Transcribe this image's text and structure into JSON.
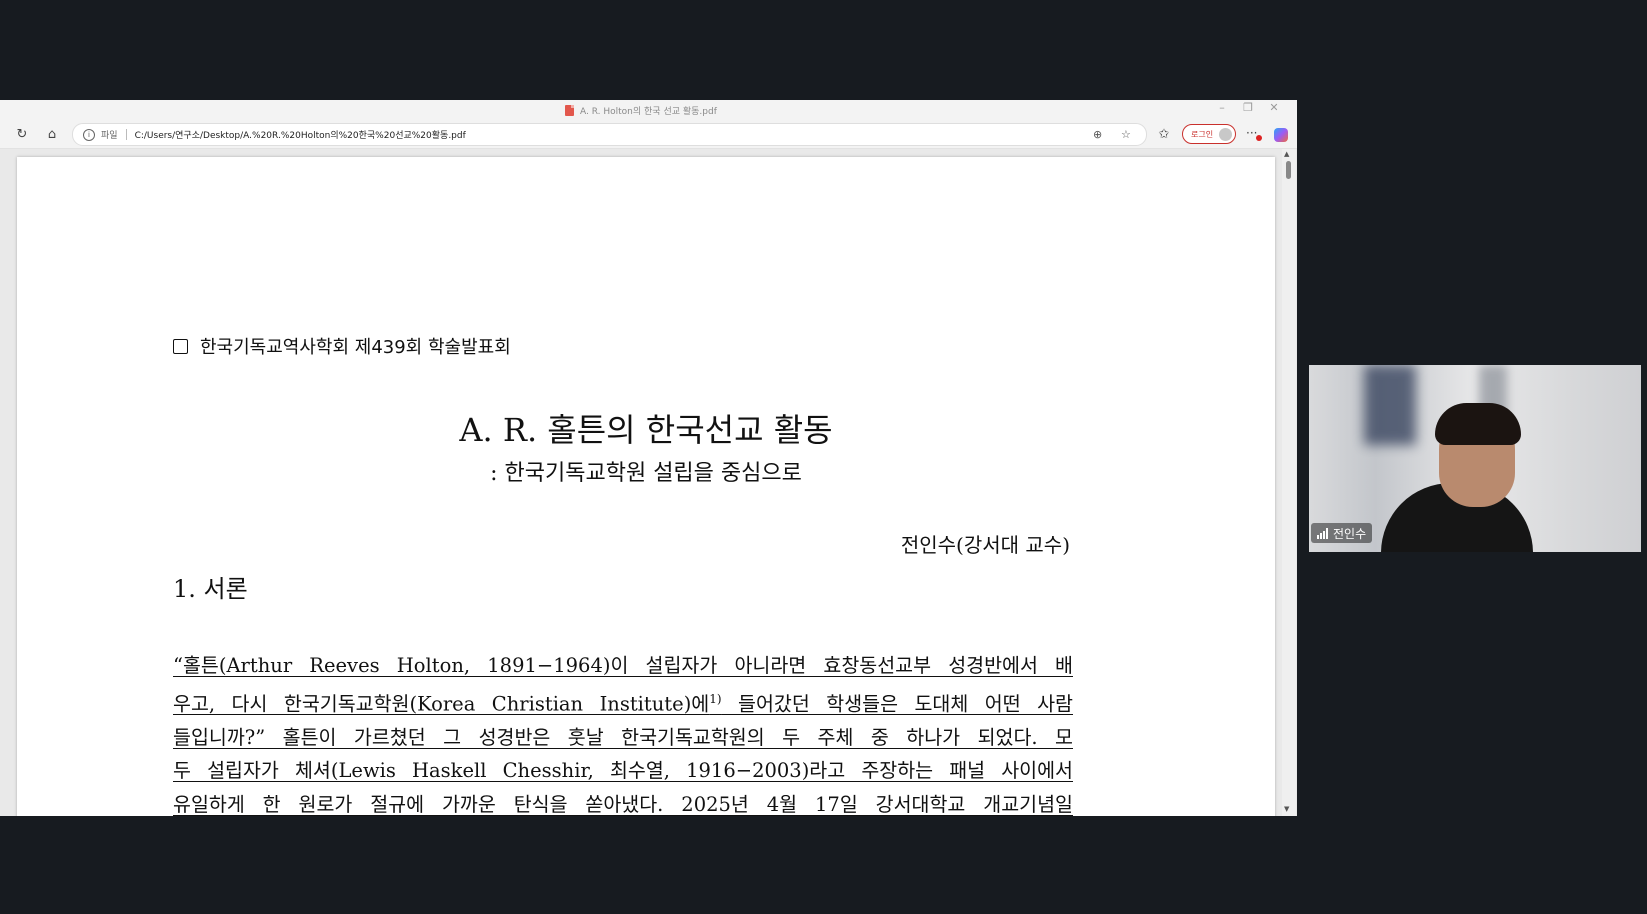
{
  "browser": {
    "window_title": "A. R. Holton의 한국 선교 활동.pdf",
    "address_scheme": "파일",
    "address_path": "C:/Users/연구소/Desktop/A.%20R.%20Holton의%20한국%20선교%20활동.pdf",
    "login_label": "로그인",
    "minimize": "–",
    "restore": "❐",
    "close": "✕",
    "refresh_icon": "↻",
    "home_icon": "⌂",
    "zoom_icon": "⊕",
    "star_icon": "☆",
    "favorites_icon": "✩",
    "more_icon": "···",
    "info_icon": "i"
  },
  "document": {
    "header": "한국기독교역사학회 제439회 학술발표회",
    "title": "A. R. 홀튼의 한국선교 활동",
    "subtitle": ": 한국기독교학원 설립을 중심으로",
    "author": "전인수(강서대 교수)",
    "section_heading": "1. 서론",
    "paragraph_lines": [
      "  “홀튼(Arthur Reeves Holton, 1891−1964)이 설립자가 아니라면 효창동선교부 성경반에서 배",
      "우고, 다시 한국기독교학원(Korea Christian Institute)에",
      "들입니까?” 홀튼이 가르쳤던 그 성경반은 훗날 한국기독교학원의 두 주체 중 하나가 되었다. 모",
      "두 설립자가 체셔(Lewis Haskell Chesshir, 최수열, 1916−2003)라고 주장하는 패널 사이에서",
      "유일하게 한 원로가 절규에 가까운 탄식을 쏟아냈다. 2025년 4월 17일 강서대학교 개교기념일"
    ],
    "footnote_mark": "1)",
    "line2_tail": " 들어갔던 학생들은 도대체 어떤 사람"
  },
  "video": {
    "participant_name": "전인수"
  }
}
